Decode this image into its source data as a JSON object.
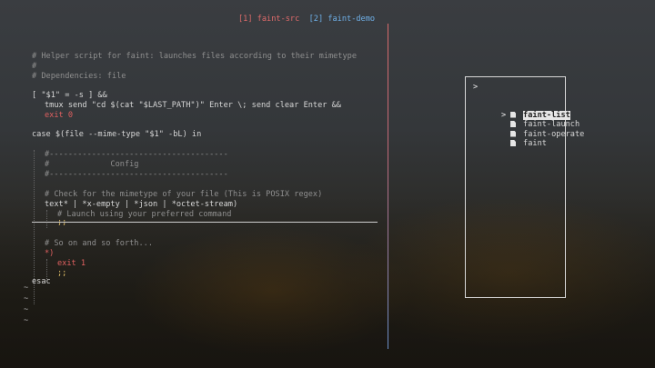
{
  "tabs": [
    {
      "label": "[1] faint-src",
      "color": "#e06b6b"
    },
    {
      "label": "[2] faint-demo",
      "color": "#6fb0e8"
    }
  ],
  "editor": {
    "lines": [
      "# Helper script for faint: launches files according to their mimetype",
      "#",
      "# Dependencies: file",
      "[ \"$1\" = -s ] &&",
      "tmux send \"cd $(cat \"$LAST_PATH\")\" Enter \\; send clear Enter &&",
      "exit 0",
      "case $(file --mime-type \"$1\" -bL) in",
      "#--------------------------------------",
      "#             Config",
      "#--------------------------------------",
      "# Check for the mimetype of your file (This is POSIX regex)",
      "text* | *x-empty | *json | *octet-stream)",
      "# Launch using your preferred command",
      ";;",
      "# So on and so forth...",
      "*)",
      "exit 1",
      ";;",
      "esac"
    ],
    "tildes": [
      "~",
      "~",
      "~",
      "~"
    ]
  },
  "picker": {
    "prompt": ">",
    "selected_marker": ">",
    "items": [
      "faint-list",
      "faint-launch",
      "faint-operate",
      "faint"
    ]
  }
}
